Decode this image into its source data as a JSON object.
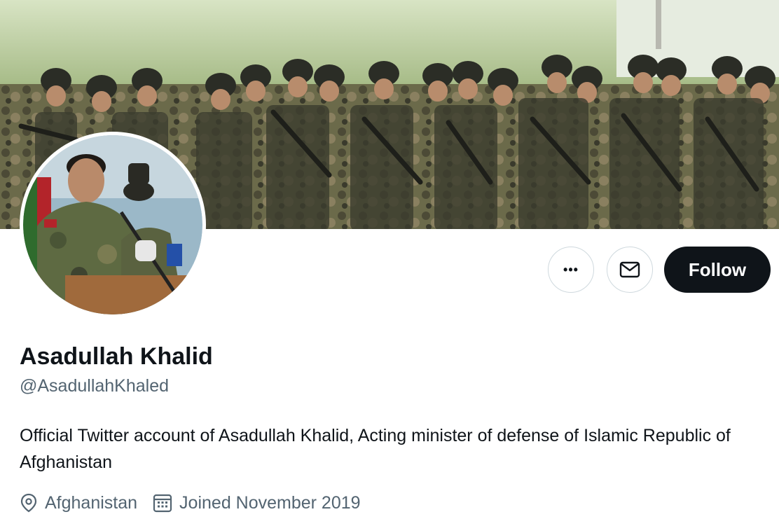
{
  "profile": {
    "display_name": "Asadullah Khalid",
    "handle": "@AsadullahKhaled",
    "bio": "Official Twitter account of Asadullah Khalid, Acting minister of defense of Islamic Republic of Afghanistan",
    "location": "Afghanistan",
    "joined": "Joined November 2019"
  },
  "actions": {
    "more_label": "•••",
    "follow_label": "Follow"
  },
  "icons": {
    "more": "more-icon",
    "message": "mail-icon",
    "location": "location-pin-icon",
    "joined": "calendar-icon"
  },
  "colors": {
    "primary_text": "#0f1419",
    "secondary_text": "#536471",
    "follow_bg": "#0f1419",
    "follow_text": "#ffffff",
    "button_border": "#cfd9de"
  }
}
